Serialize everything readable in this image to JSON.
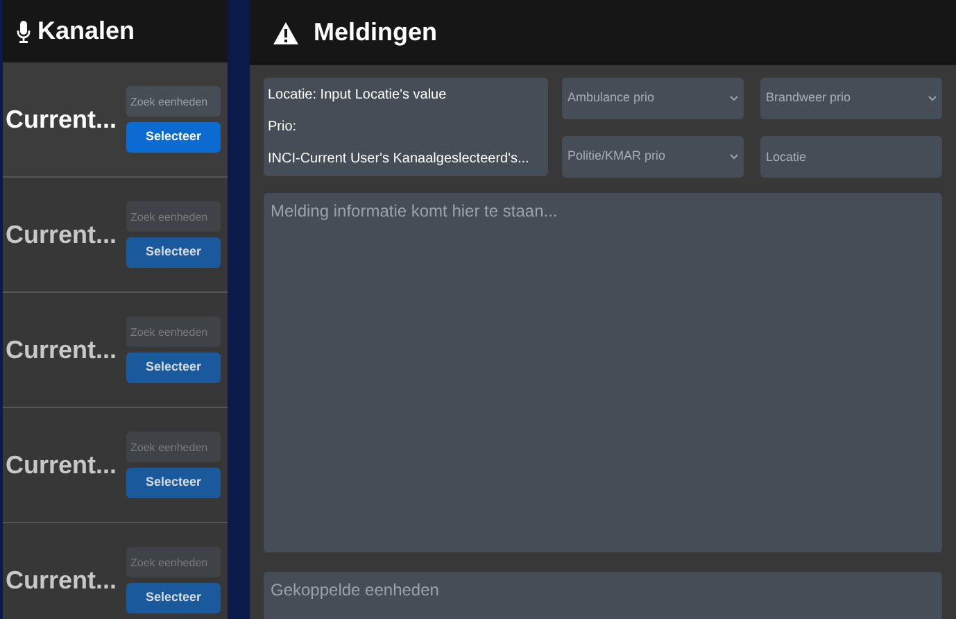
{
  "channels_panel": {
    "title": "Kanalen",
    "channels": [
      {
        "name": "Current...",
        "search_placeholder": "Zoek eenheden",
        "button": "Selecteer",
        "selected": true
      },
      {
        "name": "Current...",
        "search_placeholder": "Zoek eenheden",
        "button": "Selecteer",
        "selected": false
      },
      {
        "name": "Current...",
        "search_placeholder": "Zoek eenheden",
        "button": "Selecteer",
        "selected": false
      },
      {
        "name": "Current...",
        "search_placeholder": "Zoek eenheden",
        "button": "Selecteer",
        "selected": false
      },
      {
        "name": "Current...",
        "search_placeholder": "Zoek eenheden",
        "button": "Selecteer",
        "selected": false
      }
    ]
  },
  "reports_panel": {
    "title": "Meldingen",
    "info": [
      "Locatie: Input Locatie's value",
      "Prio:",
      "INCI-Current User's Kanaalgeslecteerd's..."
    ],
    "fields": [
      {
        "kind": "select",
        "placeholder": "Ambulance prio"
      },
      {
        "kind": "select",
        "placeholder": "Brandweer prio"
      },
      {
        "kind": "select",
        "placeholder": "Politie/KMAR prio"
      },
      {
        "kind": "input",
        "placeholder": "Locatie"
      }
    ],
    "message_placeholder": "Melding informatie komt hier te staan...",
    "units_placeholder": "Gekoppelde eenheden"
  }
}
